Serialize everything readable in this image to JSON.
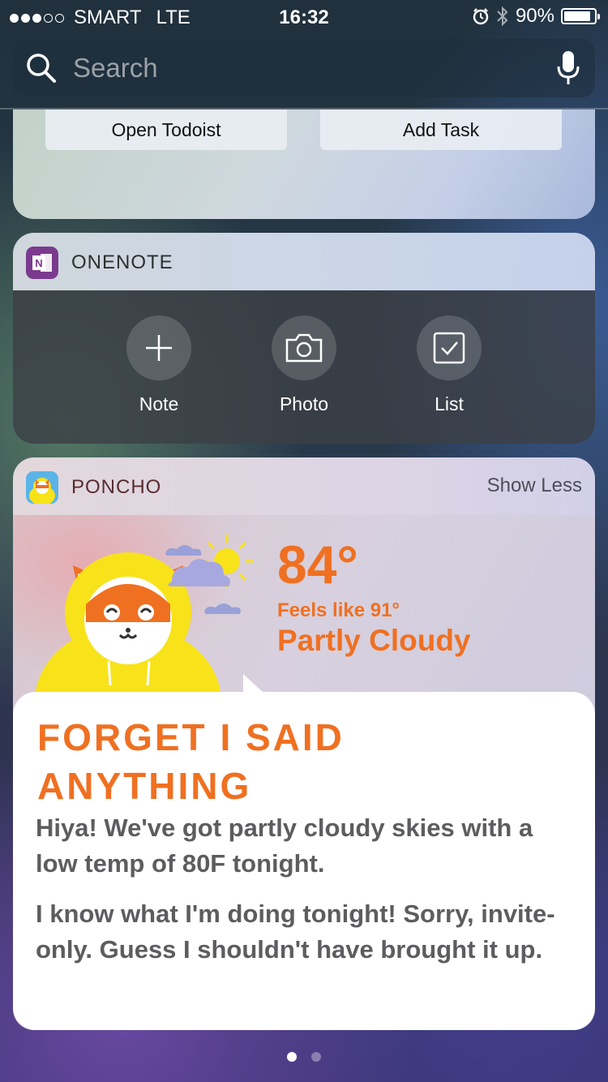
{
  "status": {
    "carrier": "SMART",
    "network": "LTE",
    "time": "16:32",
    "battery_pct": "90%",
    "battery_level": 0.9,
    "signal_bars_filled": 3,
    "signal_bars_total": 5,
    "icons": [
      "alarm-icon",
      "bluetooth-icon",
      "battery-icon"
    ]
  },
  "search": {
    "placeholder": "Search",
    "icons": [
      "search-icon",
      "microphone-icon"
    ]
  },
  "todoist": {
    "open_label": "Open Todoist",
    "add_label": "Add Task"
  },
  "onenote": {
    "title": "ONENOTE",
    "icon": "onenote-icon",
    "actions": [
      {
        "label": "Note",
        "icon": "plus-icon"
      },
      {
        "label": "Photo",
        "icon": "camera-icon"
      },
      {
        "label": "List",
        "icon": "checkbox-icon"
      }
    ]
  },
  "poncho": {
    "title": "PONCHO",
    "show_less": "Show Less",
    "temperature": "84°",
    "feels_like": "Feels like 91°",
    "condition": "Partly Cloudy",
    "headline": "FORGET I SAID ANYTHING",
    "paragraph1": "Hiya! We've got partly cloudy skies with a low temp of 80F tonight.",
    "paragraph2": "I know what I'm doing tonight! Sorry, invite-only. Guess I shouldn't have brought it up."
  },
  "pager": {
    "count": 2,
    "active": 0
  },
  "colors": {
    "accent": "#f07021",
    "onenote": "#7b3a8e",
    "poncho_yellow": "#f8e21a"
  }
}
